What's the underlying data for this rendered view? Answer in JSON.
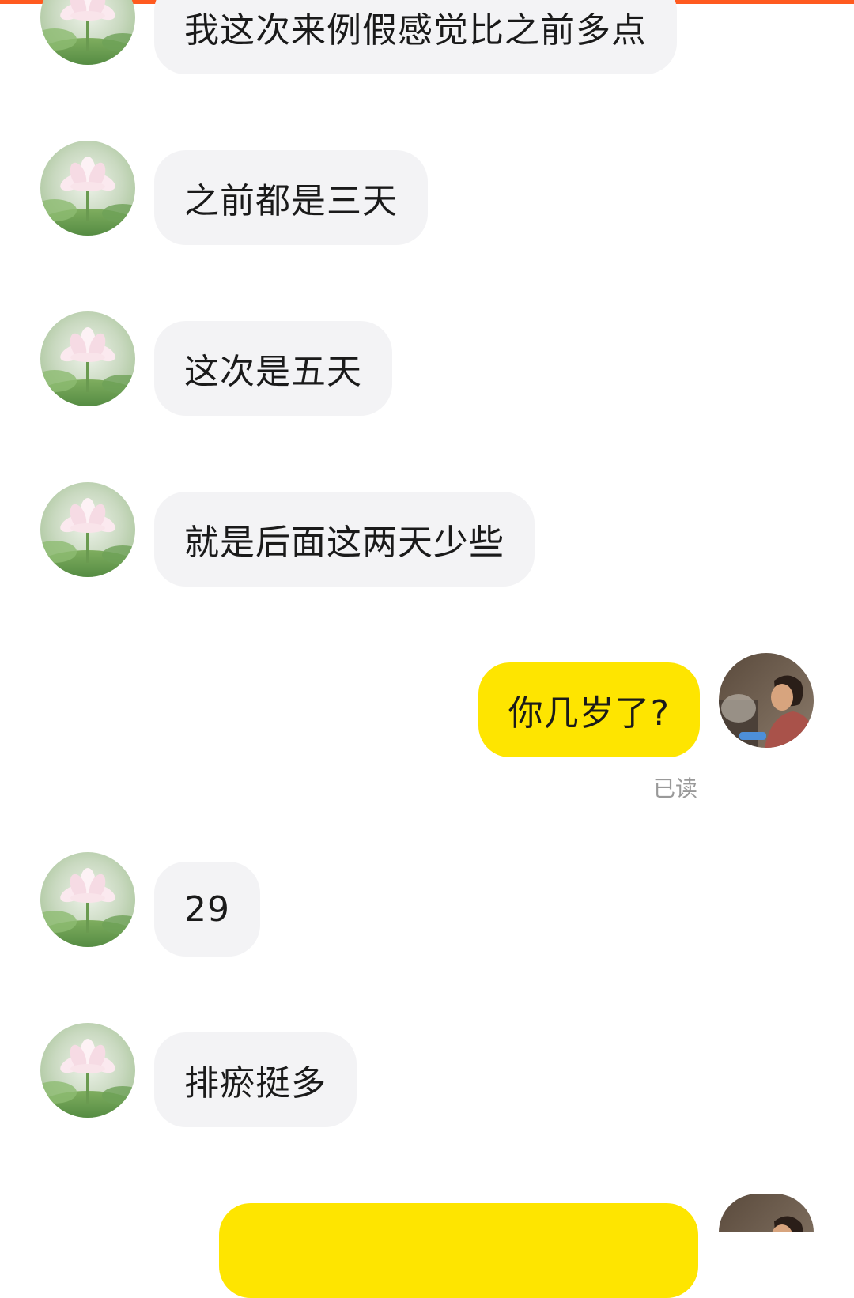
{
  "theme": {
    "accent": "#ff5a1f",
    "incoming_bubble": "#f3f3f5",
    "outgoing_bubble": "#fee500"
  },
  "contact": {
    "avatar_icon": "lotus-flower-avatar"
  },
  "me": {
    "avatar_icon": "woman-cooking-avatar"
  },
  "messages": [
    {
      "side": "in",
      "text": "我这次来例假感觉比之前多点"
    },
    {
      "side": "in",
      "text": "之前都是三天"
    },
    {
      "side": "in",
      "text": "这次是五天"
    },
    {
      "side": "in",
      "text": "就是后面这两天少些"
    },
    {
      "side": "out",
      "text": "你几岁了?",
      "status": "已读"
    },
    {
      "side": "in",
      "text": "29"
    },
    {
      "side": "in",
      "text": "排瘀挺多"
    },
    {
      "side": "out",
      "text": ""
    }
  ]
}
